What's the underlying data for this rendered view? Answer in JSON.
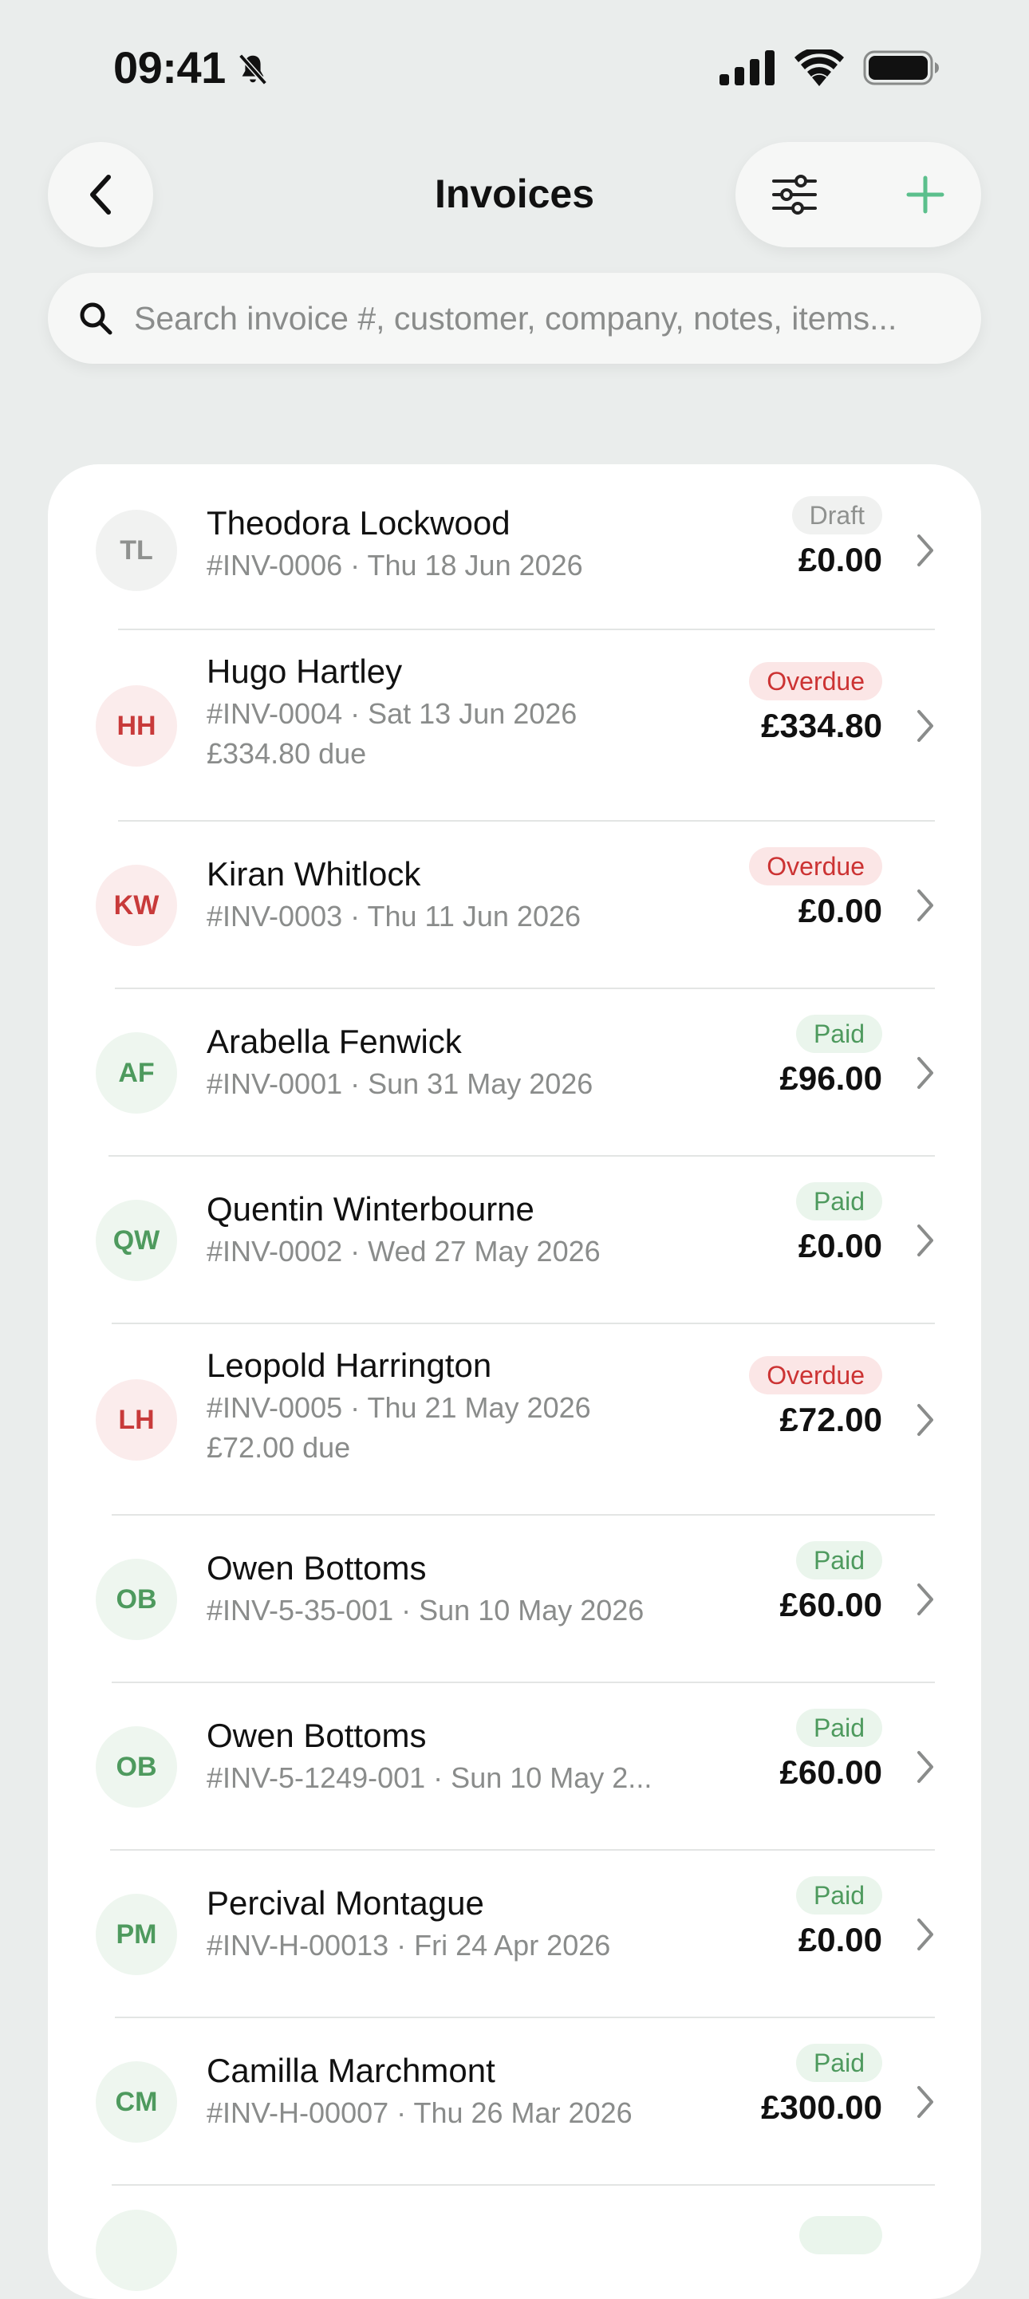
{
  "status_bar": {
    "time": "09:41"
  },
  "header": {
    "title": "Invoices"
  },
  "search": {
    "placeholder": "Search invoice #, customer, company, notes, items..."
  },
  "colors": {
    "accent": "#5bbf8c",
    "overdue": "#cc3333",
    "paid": "#4e9a5e",
    "draft": "#8f918f"
  },
  "invoices": [
    {
      "initials": "TL",
      "name": "Theodora Lockwood",
      "meta": "#INV-0006 · Thu 18 Jun 2026",
      "due": "",
      "status": "Draft",
      "amount": "£0.00"
    },
    {
      "initials": "HH",
      "name": "Hugo Hartley",
      "meta": "#INV-0004 · Sat 13 Jun 2026",
      "due": "£334.80 due",
      "status": "Overdue",
      "amount": "£334.80"
    },
    {
      "initials": "KW",
      "name": "Kiran Whitlock",
      "meta": "#INV-0003 · Thu 11 Jun 2026",
      "due": "",
      "status": "Overdue",
      "amount": "£0.00"
    },
    {
      "initials": "AF",
      "name": "Arabella Fenwick",
      "meta": "#INV-0001 · Sun 31 May 2026",
      "due": "",
      "status": "Paid",
      "amount": "£96.00"
    },
    {
      "initials": "QW",
      "name": "Quentin Winterbourne",
      "meta": "#INV-0002 · Wed 27 May 2026",
      "due": "",
      "status": "Paid",
      "amount": "£0.00"
    },
    {
      "initials": "LH",
      "name": "Leopold Harrington",
      "meta": "#INV-0005 · Thu 21 May 2026",
      "due": "£72.00 due",
      "status": "Overdue",
      "amount": "£72.00"
    },
    {
      "initials": "OB",
      "name": "Owen Bottoms",
      "meta": "#INV-5-35-001 · Sun 10 May 2026",
      "due": "",
      "status": "Paid",
      "amount": "£60.00"
    },
    {
      "initials": "OB",
      "name": "Owen Bottoms",
      "meta": "#INV-5-1249-001 · Sun 10 May 2...",
      "due": "",
      "status": "Paid",
      "amount": "£60.00"
    },
    {
      "initials": "PM",
      "name": "Percival Montague",
      "meta": "#INV-H-00013 · Fri 24 Apr 2026",
      "due": "",
      "status": "Paid",
      "amount": "£0.00"
    },
    {
      "initials": "CM",
      "name": "Camilla Marchmont",
      "meta": "#INV-H-00007 · Thu 26 Mar 2026",
      "due": "",
      "status": "Paid",
      "amount": "£300.00"
    }
  ]
}
